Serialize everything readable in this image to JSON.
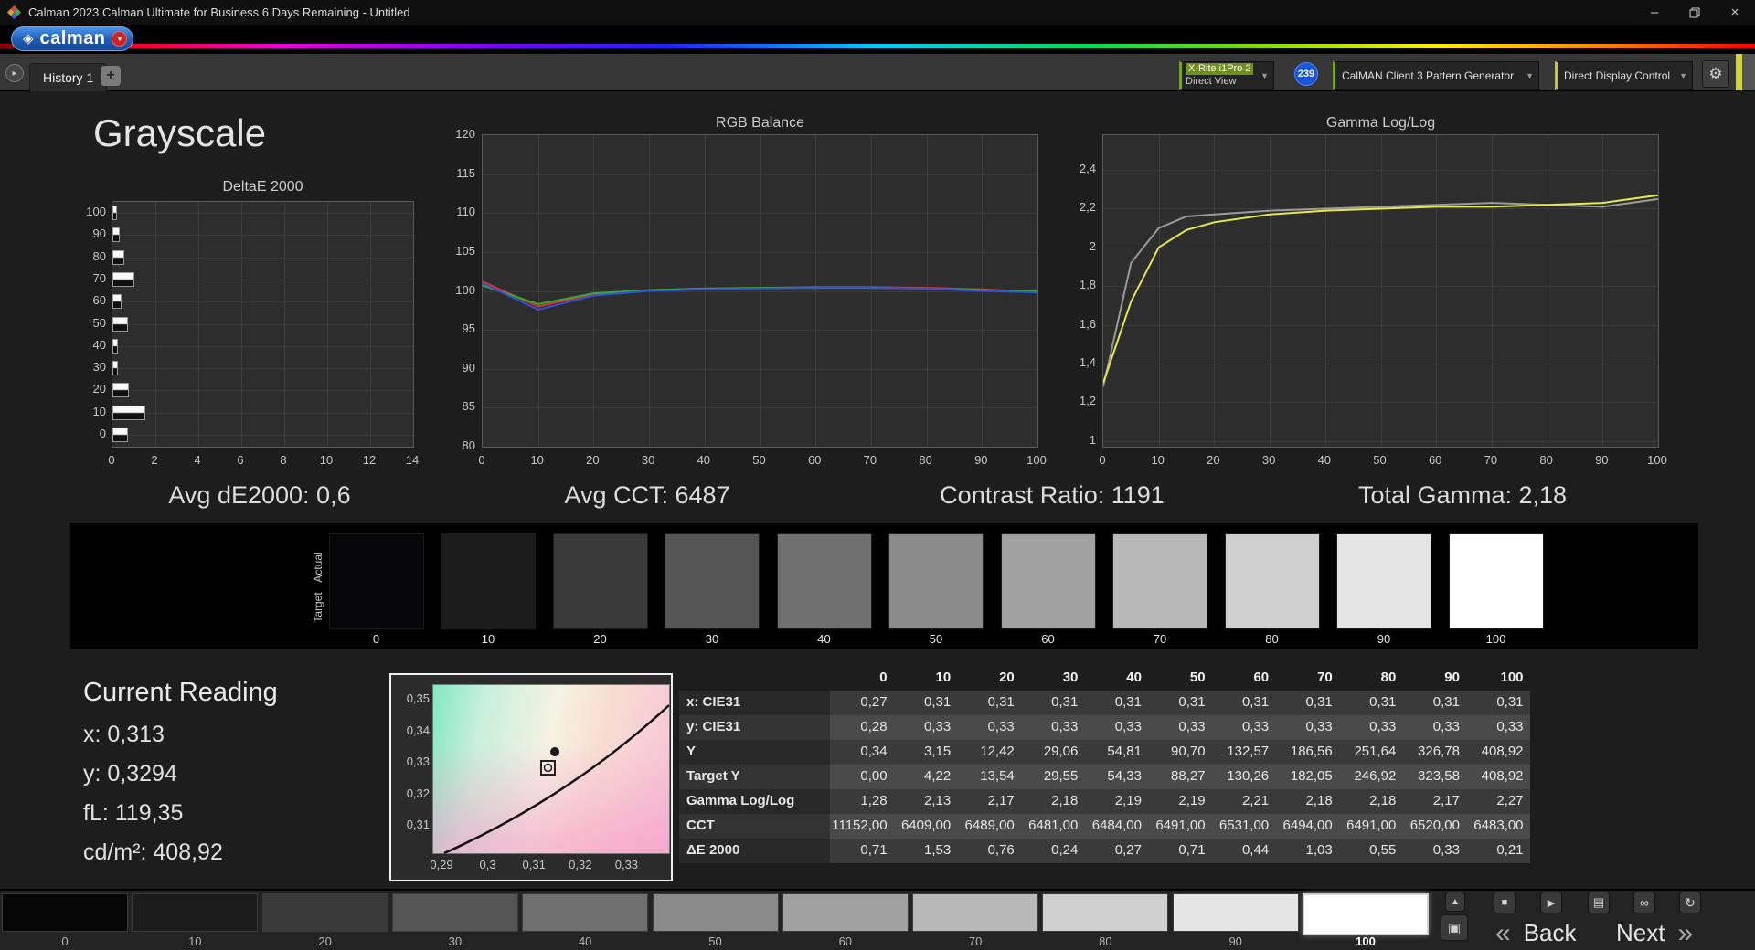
{
  "window": {
    "title": "Calman 2023 Calman Ultimate for Business 6 Days Remaining  - Untitled"
  },
  "brand": {
    "name": "calman"
  },
  "icons": {
    "caret_down": "▼",
    "history_arrow": "▸",
    "add_tab": "+",
    "gear": "⚙",
    "diamond": "◈",
    "minimize": "–",
    "close": "×",
    "panel_up": "▲",
    "panel_square": "▣",
    "stop": "■",
    "play": "▶",
    "save": "▤",
    "link": "∞",
    "refresh": "↻",
    "back_chevron": "«",
    "next_chevron": "»"
  },
  "tabbar": {
    "history_tab": "History 1",
    "meter_line1": "X-Rite i1Pro 2",
    "meter_line2": "Direct View",
    "badge": "239",
    "pattern_generator": "CalMAN Client 3 Pattern Generator",
    "display_control": "Direct Display Control"
  },
  "page": {
    "title": "Grayscale"
  },
  "stats": {
    "avg_de": "Avg dE2000: 0,6",
    "avg_cct": "Avg CCT: 6487",
    "contrast": "Contrast Ratio: 1191",
    "total_gamma": "Total Gamma: 2,18"
  },
  "chart_data": [
    {
      "type": "bar",
      "title": "DeltaE 2000",
      "orientation": "horizontal",
      "categories": [
        100,
        90,
        80,
        70,
        60,
        50,
        40,
        30,
        20,
        10,
        0
      ],
      "values": [
        0.21,
        0.33,
        0.55,
        1.03,
        0.44,
        0.71,
        0.27,
        0.24,
        0.76,
        1.53,
        0.71
      ],
      "xlim": [
        0,
        14
      ],
      "x_ticks": [
        0,
        2,
        4,
        6,
        8,
        10,
        12,
        14
      ],
      "y_tick_labels": [
        "100",
        "90",
        "80",
        "70",
        "60",
        "50",
        "40",
        "30",
        "20",
        "10",
        "0"
      ],
      "grid": true
    },
    {
      "type": "line",
      "title": "RGB Balance",
      "x": [
        0,
        10,
        20,
        30,
        40,
        50,
        60,
        70,
        80,
        90,
        100
      ],
      "series": [
        {
          "name": "red",
          "color": "#e03030",
          "values": [
            101.2,
            98.0,
            99.6,
            100.1,
            100.3,
            100.4,
            100.5,
            100.5,
            100.4,
            100.2,
            99.9
          ]
        },
        {
          "name": "green",
          "color": "#30b030",
          "values": [
            100.7,
            98.3,
            99.7,
            100.1,
            100.3,
            100.4,
            100.4,
            100.4,
            100.3,
            100.1,
            100.0
          ]
        },
        {
          "name": "blue",
          "color": "#3050e0",
          "values": [
            101.0,
            97.6,
            99.4,
            100.0,
            100.2,
            100.3,
            100.4,
            100.4,
            100.3,
            100.0,
            99.8
          ]
        }
      ],
      "ylim": [
        80,
        120
      ],
      "y_ticks": [
        120,
        115,
        110,
        105,
        100,
        95,
        90,
        85,
        80
      ],
      "x_ticks": [
        0,
        10,
        20,
        30,
        40,
        50,
        60,
        70,
        80,
        90,
        100
      ],
      "grid": true
    },
    {
      "type": "line",
      "title": "Gamma Log/Log",
      "x": [
        0,
        5,
        10,
        15,
        20,
        30,
        40,
        50,
        60,
        70,
        80,
        90,
        100
      ],
      "series": [
        {
          "name": "target-gamma",
          "color": "#9a9a9a",
          "values": [
            1.28,
            1.92,
            2.1,
            2.16,
            2.17,
            2.19,
            2.2,
            2.21,
            2.22,
            2.23,
            2.22,
            2.21,
            2.25
          ]
        },
        {
          "name": "measured-gamma",
          "color": "#e8e84a",
          "values": [
            1.3,
            1.72,
            2.0,
            2.09,
            2.13,
            2.17,
            2.19,
            2.2,
            2.21,
            2.21,
            2.22,
            2.23,
            2.27
          ]
        }
      ],
      "ylim": [
        0.97,
        2.58
      ],
      "y_ticks": [
        2.4,
        2.2,
        2.0,
        1.8,
        1.6,
        1.4,
        1.2,
        1.0
      ],
      "y_tick_labels": [
        "2,4",
        "2,2",
        "2",
        "1,8",
        "1,6",
        "1,4",
        "1,2",
        "1"
      ],
      "x_ticks": [
        0,
        10,
        20,
        30,
        40,
        50,
        60,
        70,
        80,
        90,
        100
      ],
      "grid": true
    }
  ],
  "swatch_strip": {
    "row_labels": [
      "Actual",
      "Target"
    ],
    "steps": [
      "0",
      "10",
      "20",
      "30",
      "40",
      "50",
      "60",
      "70",
      "80",
      "90",
      "100"
    ],
    "colors": [
      "#060608",
      "#1b1b1b",
      "#3a3a3a",
      "#555555",
      "#6f6f6f",
      "#8a8a8a",
      "#a1a1a1",
      "#b8b8b8",
      "#cfcfcf",
      "#e5e5e5",
      "#ffffff"
    ]
  },
  "current_reading": {
    "title": "Current Reading",
    "x": "x: 0,313",
    "y": "y: 0,3294",
    "fl": "fL: 119,35",
    "cdm2": "cd/m²: 408,92"
  },
  "cie": {
    "y_ticks": [
      "0,35",
      "0,34",
      "0,33",
      "0,32",
      "0,31"
    ],
    "x_ticks": [
      "0,29",
      "0,3",
      "0,31",
      "0,32",
      "0,33"
    ]
  },
  "table": {
    "columns": [
      "0",
      "10",
      "20",
      "30",
      "40",
      "50",
      "60",
      "70",
      "80",
      "90",
      "100"
    ],
    "rows": [
      {
        "label": "x: CIE31",
        "values": [
          "0,27",
          "0,31",
          "0,31",
          "0,31",
          "0,31",
          "0,31",
          "0,31",
          "0,31",
          "0,31",
          "0,31",
          "0,31"
        ]
      },
      {
        "label": "y: CIE31",
        "values": [
          "0,28",
          "0,33",
          "0,33",
          "0,33",
          "0,33",
          "0,33",
          "0,33",
          "0,33",
          "0,33",
          "0,33",
          "0,33"
        ]
      },
      {
        "label": "Y",
        "values": [
          "0,34",
          "3,15",
          "12,42",
          "29,06",
          "54,81",
          "90,70",
          "132,57",
          "186,56",
          "251,64",
          "326,78",
          "408,92"
        ]
      },
      {
        "label": "Target Y",
        "values": [
          "0,00",
          "4,22",
          "13,54",
          "29,55",
          "54,33",
          "88,27",
          "130,26",
          "182,05",
          "246,92",
          "323,58",
          "408,92"
        ]
      },
      {
        "label": "Gamma Log/Log",
        "values": [
          "1,28",
          "2,13",
          "2,17",
          "2,18",
          "2,19",
          "2,19",
          "2,21",
          "2,18",
          "2,18",
          "2,17",
          "2,27"
        ]
      },
      {
        "label": "CCT",
        "values": [
          "11152,00",
          "6409,00",
          "6489,00",
          "6481,00",
          "6484,00",
          "6491,00",
          "6531,00",
          "6494,00",
          "6491,00",
          "6520,00",
          "6483,00"
        ]
      },
      {
        "label": "ΔE 2000",
        "values": [
          "0,71",
          "1,53",
          "0,76",
          "0,24",
          "0,27",
          "0,71",
          "0,44",
          "1,03",
          "0,55",
          "0,33",
          "0,21"
        ]
      }
    ]
  },
  "bottom": {
    "patches": [
      "0",
      "10",
      "20",
      "30",
      "40",
      "50",
      "60",
      "70",
      "80",
      "90",
      "100"
    ],
    "patch_colors": [
      "#050505",
      "#1b1b1b",
      "#3a3a3a",
      "#555555",
      "#6f6f6f",
      "#8a8a8a",
      "#a1a1a1",
      "#b8b8b8",
      "#cfcfcf",
      "#e5e5e5",
      "#ffffff"
    ],
    "selected_index": 10,
    "back": "Back",
    "next": "Next"
  }
}
